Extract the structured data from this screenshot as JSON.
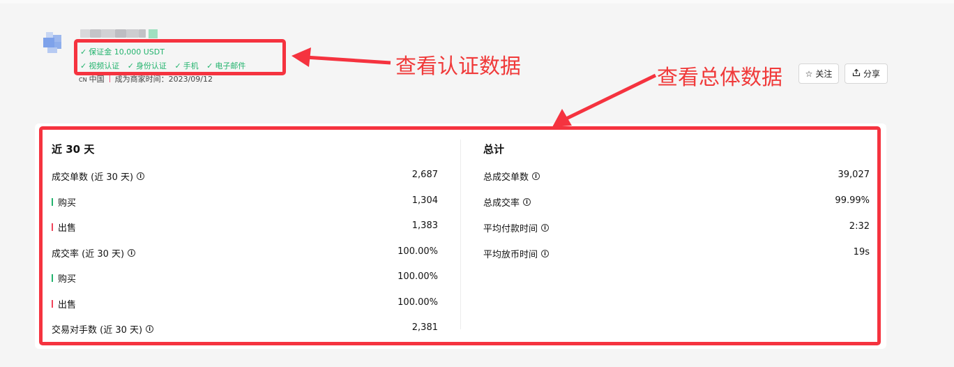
{
  "profile": {
    "certifications_line1": [
      "保证金 10,000 USDT"
    ],
    "certifications_line2": [
      "视频认证",
      "身份认证",
      "手机",
      "电子邮件"
    ],
    "country_code": "CN",
    "country": "中国",
    "merchant_since": "成为商家时间：2023/09/12"
  },
  "actions": {
    "follow_label": "关注",
    "share_label": "分享"
  },
  "annotations": {
    "cert_note": "查看认证数据",
    "stats_note": "查看总体数据"
  },
  "recent": {
    "title": "近 30 天",
    "rows": [
      {
        "label": "成交单数 (近 30 天)",
        "value": "2,687",
        "info": true,
        "bar": ""
      },
      {
        "label": "购买",
        "value": "1,304",
        "info": false,
        "bar": "buy"
      },
      {
        "label": "出售",
        "value": "1,383",
        "info": false,
        "bar": "sell"
      },
      {
        "label": "成交率 (近 30 天)",
        "value": "100.00%",
        "info": true,
        "bar": ""
      },
      {
        "label": "购买",
        "value": "100.00%",
        "info": false,
        "bar": "buy"
      },
      {
        "label": "出售",
        "value": "100.00%",
        "info": false,
        "bar": "sell"
      },
      {
        "label": "交易对手数 (近 30 天)",
        "value": "2,381",
        "info": true,
        "bar": ""
      }
    ]
  },
  "total": {
    "title": "总计",
    "rows": [
      {
        "label": "总成交单数",
        "value": "39,027",
        "info": true
      },
      {
        "label": "总成交率",
        "value": "99.99%",
        "info": true
      },
      {
        "label": "平均付款时间",
        "value": "2:32",
        "info": true
      },
      {
        "label": "平均放币时间",
        "value": "19s",
        "info": true
      }
    ]
  },
  "colors": {
    "annotation_red": "#f5333f",
    "verified_green": "#22b36d",
    "buy_green": "#22b36d",
    "sell_red": "#f0445a"
  }
}
